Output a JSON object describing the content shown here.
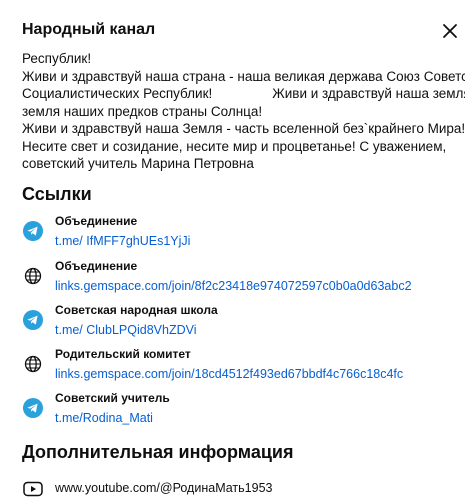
{
  "dialog": {
    "title": "Народный канал"
  },
  "description": {
    "lines": [
      "Республик!",
      "Живи и здравствуй наша страна - наша великая держава Союз Советских",
      "Социалистических Республик!                Живи и здравствуй наша земля -",
      "земля наших предков страны Солнца!",
      "Живи и здравствуй наша Земля - часть вселенной без`крайнего Мира!",
      "Несите свет и созидание, несите мир и процветанье! С уважением,",
      "советский учитель Марина Петровна"
    ]
  },
  "links_section": {
    "title": "Ссылки",
    "items": [
      {
        "name": "Объединение",
        "url": "t.me/ IfMFF7ghUEs1YjJi",
        "icon": "telegram-icon"
      },
      {
        "name": "Объединение",
        "url": "links.gemspace.com/join/8f2c23418e974072597c0b0a0d63abc2",
        "icon": "globe-icon"
      },
      {
        "name": "Советская народная школа",
        "url": "t.me/ ClubLPQid8VhZDVi",
        "icon": "telegram-icon"
      },
      {
        "name": "Родительский комитет",
        "url": "links.gemspace.com/join/18cd4512f493ed67bbdf4c766c18c4fc",
        "icon": "globe-icon"
      },
      {
        "name": "Советский учитель",
        "url": "t.me/Rodina_Mati",
        "icon": "telegram-icon"
      }
    ]
  },
  "info_section": {
    "title": "Дополнительная информация",
    "items": [
      {
        "text": "www.youtube.com/@РодинаМать1953",
        "icon": "youtube-icon"
      }
    ]
  },
  "colors": {
    "telegram": "#2aa1da",
    "link": "#065fd4",
    "text": "#0f0f0f"
  }
}
